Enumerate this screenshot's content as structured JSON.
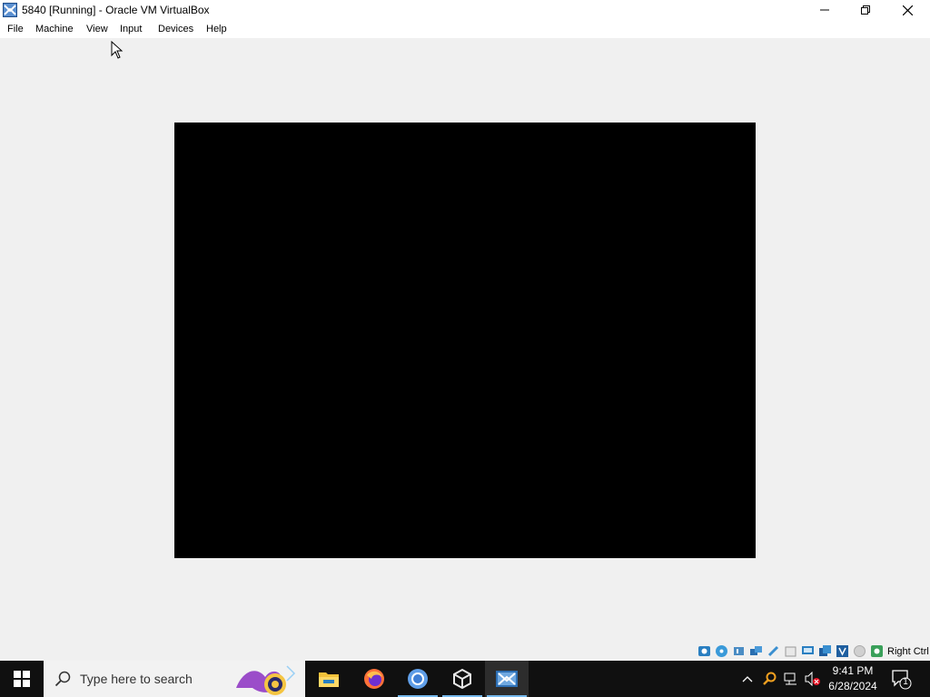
{
  "window": {
    "title": "5840 [Running] - Oracle VM VirtualBox",
    "controls": {
      "minimize": "minimize",
      "restore": "restore",
      "close": "close"
    }
  },
  "menubar": {
    "items": [
      {
        "label": "File"
      },
      {
        "label": "Machine"
      },
      {
        "label": "View"
      },
      {
        "label": "Input"
      },
      {
        "label": "Devices"
      },
      {
        "label": "Help"
      }
    ]
  },
  "statusbar": {
    "icons": [
      "hard-disk-icon",
      "optical-drive-icon",
      "audio-icon",
      "network-icon",
      "usb-icon",
      "shared-folders-icon",
      "display-icon",
      "video-capture-icon",
      "capture-icon",
      "mouse-integration-icon",
      "keyboard-icon",
      "host-key-icon"
    ],
    "host_key": "Right Ctrl"
  },
  "taskbar": {
    "search_placeholder": "Type here to search",
    "apps": [
      "file-explorer-icon",
      "firefox-icon",
      "chrome-icon",
      "virtualbox-icon",
      "vm-window-icon"
    ],
    "clock": {
      "time": "9:41 PM",
      "date": "6/28/2024"
    },
    "notification_count": "1"
  },
  "colors": {
    "taskbar": "#101010",
    "accent": "#76b9ed",
    "vm_screen": "#000000"
  }
}
